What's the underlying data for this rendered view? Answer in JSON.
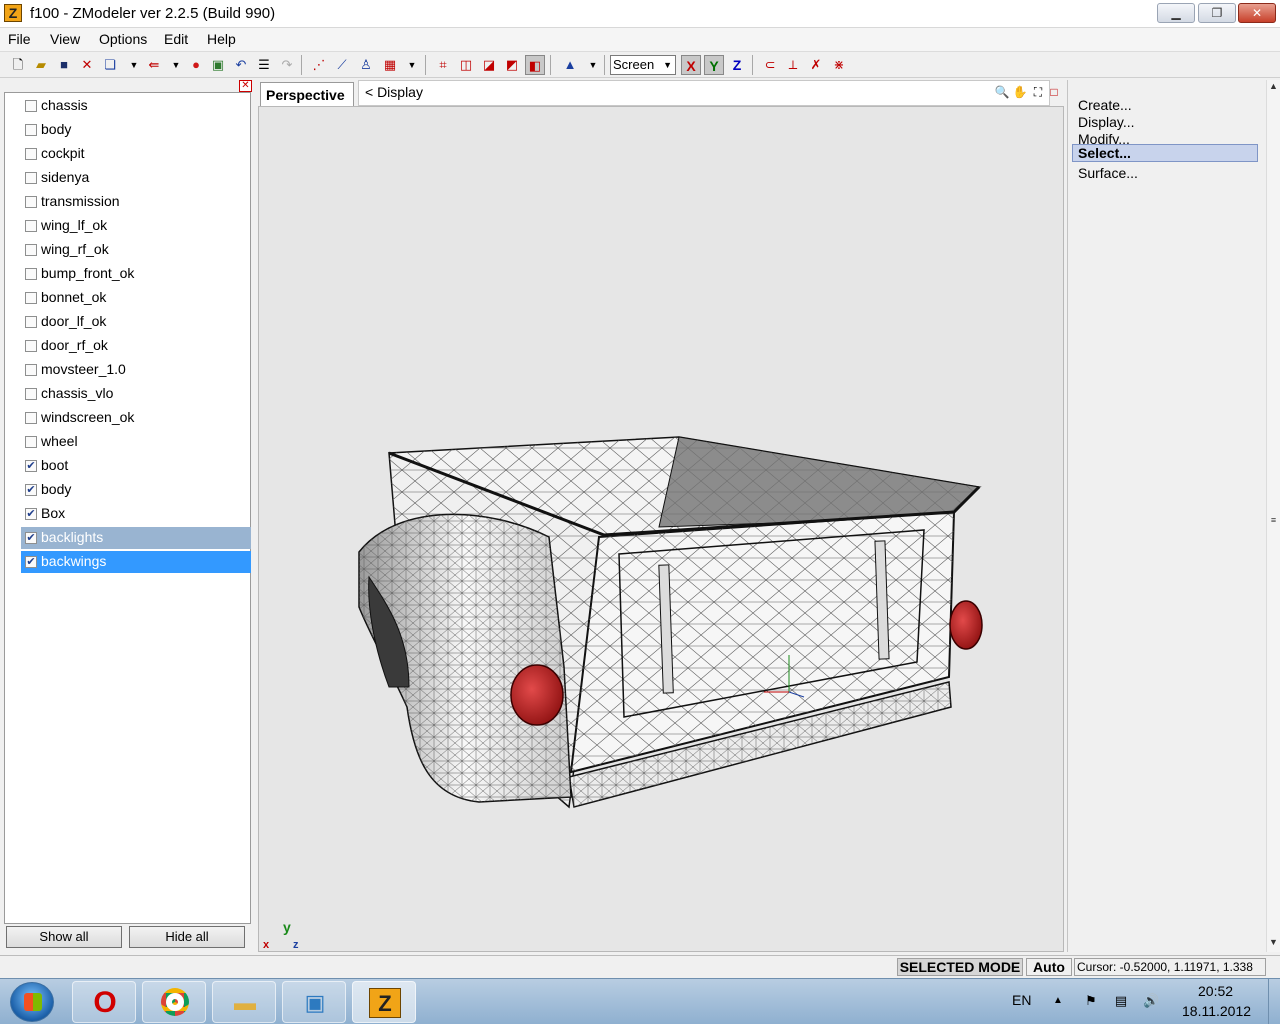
{
  "window": {
    "app_icon_letter": "Z",
    "title": "f100 - ZModeler ver 2.2.5 (Build 990)",
    "minimize_glyph": "▁",
    "maximize_glyph": "❐",
    "close_glyph": "✕"
  },
  "menu": [
    "File",
    "View",
    "Options",
    "Edit",
    "Help"
  ],
  "toolbar": {
    "space_select": "Screen",
    "axis_x": "X",
    "axis_y": "Y",
    "axis_z": "Z"
  },
  "objects_panel": {
    "items": [
      {
        "label": "chassis",
        "checked": false
      },
      {
        "label": "body",
        "checked": false
      },
      {
        "label": "cockpit",
        "checked": false
      },
      {
        "label": "sidenya",
        "checked": false
      },
      {
        "label": "transmission",
        "checked": false
      },
      {
        "label": "wing_lf_ok",
        "checked": false
      },
      {
        "label": "wing_rf_ok",
        "checked": false
      },
      {
        "label": "bump_front_ok",
        "checked": false
      },
      {
        "label": "bonnet_ok",
        "checked": false
      },
      {
        "label": "door_lf_ok",
        "checked": false
      },
      {
        "label": "door_rf_ok",
        "checked": false
      },
      {
        "label": "movsteer_1.0",
        "checked": false
      },
      {
        "label": "chassis_vlo",
        "checked": false
      },
      {
        "label": "windscreen_ok",
        "checked": false
      },
      {
        "label": "wheel",
        "checked": false
      },
      {
        "label": "boot",
        "checked": true
      },
      {
        "label": "body",
        "checked": true
      },
      {
        "label": "Box",
        "checked": true
      },
      {
        "label": "backlights",
        "checked": true
      },
      {
        "label": "backwings",
        "checked": true
      }
    ],
    "show_all": "Show all",
    "hide_all": "Hide all"
  },
  "viewport": {
    "tab_label": "Perspective",
    "display_label": "<  Display",
    "gizmo_y": "y",
    "gizmo_x": "x",
    "gizmo_z": "z"
  },
  "command_panel": {
    "items": [
      "Create...",
      "Display...",
      "Modify...",
      "Select...",
      "Surface..."
    ],
    "active": "Select..."
  },
  "statusbar": {
    "mode": "SELECTED MODE",
    "auto": "Auto",
    "cursor": "Cursor: -0.52000, 1.11971, 1.338"
  },
  "taskbar": {
    "language": "EN",
    "time": "20:52",
    "date": "18.11.2012"
  },
  "colors": {
    "selection_blue": "#3399ff",
    "selection_grey": "#99b4d1",
    "viewport_bg": "#e6e6e6",
    "lights_red": "#b11818"
  }
}
